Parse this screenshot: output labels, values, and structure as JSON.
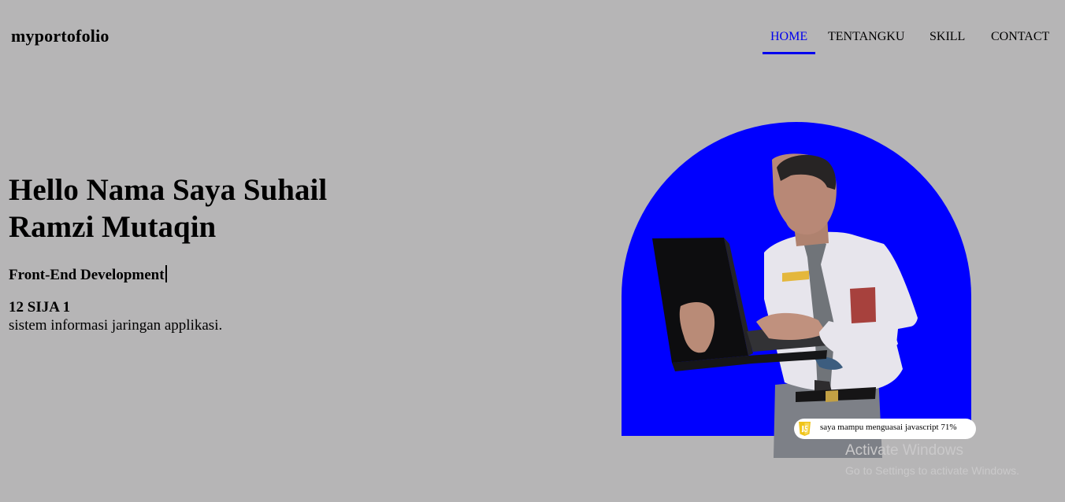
{
  "header": {
    "logo": "myportofolio",
    "nav": {
      "home": "HOME",
      "tentangku": "TENTANGKU",
      "skill": "SKILL",
      "contact": "CONTACT",
      "active": "HOME"
    }
  },
  "hero": {
    "title": "Hello Nama Saya Suhail Ramzi Mutaqin",
    "role": "Front-End Development",
    "class_name": "12 SIJA 1",
    "major": "sistem informasi jaringan applikasi."
  },
  "skill_badge": {
    "icon": "javascript-icon",
    "text": "saya mampu menguasai javascript 71%"
  },
  "watermark": {
    "title": "Activate Windows",
    "subtitle": "Go to Settings to activate Windows."
  },
  "colors": {
    "background": "#b6b5b6",
    "accent": "#0000ff",
    "nav_active": "#0000ee",
    "badge": "#ffffff",
    "js_yellow": "#f0c419"
  }
}
